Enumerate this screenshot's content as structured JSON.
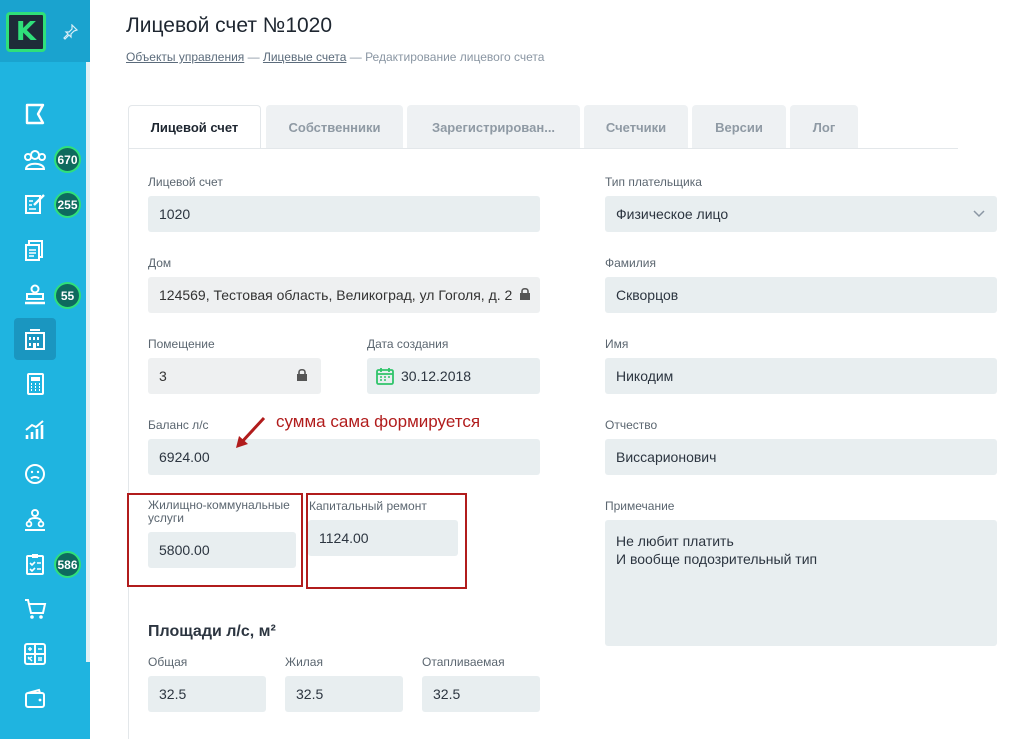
{
  "sidebar": {
    "logo_letter": "K",
    "pin_icon": "pin-icon",
    "items": [
      {
        "icon": "flag-icon",
        "badge": null
      },
      {
        "icon": "people-group-icon",
        "badge": "670"
      },
      {
        "icon": "edit-document-icon",
        "badge": "255"
      },
      {
        "icon": "documents-icon",
        "badge": null
      },
      {
        "icon": "dispatcher-icon",
        "badge": "55"
      },
      {
        "icon": "building-icon",
        "badge": null,
        "active": true
      },
      {
        "icon": "calculator-icon",
        "badge": null
      },
      {
        "icon": "analytics-icon",
        "badge": null
      },
      {
        "icon": "sad-face-icon",
        "badge": null
      },
      {
        "icon": "team-icon",
        "badge": null
      },
      {
        "icon": "checklist-icon",
        "badge": "586"
      },
      {
        "icon": "cart-icon",
        "badge": null
      },
      {
        "icon": "calc-grid-icon",
        "badge": null
      },
      {
        "icon": "wallet-icon",
        "badge": null
      }
    ]
  },
  "header": {
    "title": "Лицевой счет №1020",
    "breadcrumb": {
      "item1": "Объекты управления",
      "sep": " — ",
      "item2": "Лицевые счета",
      "item3": "Редактирование лицевого счета"
    }
  },
  "tabs": [
    "Лицевой счет",
    "Собственники",
    "Зарегистрирован...",
    "Счетчики",
    "Версии",
    "Лог"
  ],
  "form": {
    "account_label": "Лицевой счет",
    "account_value": "1020",
    "house_label": "Дом",
    "house_value": "124569, Тестовая область, Великоград, ул Гоголя, д. 2",
    "room_label": "Помещение",
    "room_value": "3",
    "created_label": "Дата создания",
    "created_value": "30.12.2018",
    "balance_label": "Баланс л/с",
    "balance_value": "6924.00",
    "housing_label": "Жилищно-коммунальные услуги",
    "housing_value": "5800.00",
    "capital_label": "Капитальный ремонт",
    "capital_value": "1124.00",
    "area_title": "Площади л/с, м²",
    "area_total_label": "Общая",
    "area_total_value": "32.5",
    "area_living_label": "Жилая",
    "area_living_value": "32.5",
    "area_heated_label": "Отапливаемая",
    "area_heated_value": "32.5",
    "payer_type_label": "Тип плательщика",
    "payer_type_value": "Физическое лицо",
    "lastname_label": "Фамилия",
    "lastname_value": "Скворцов",
    "firstname_label": "Имя",
    "firstname_value": "Никодим",
    "patronymic_label": "Отчество",
    "patronymic_value": "Виссарионович",
    "note_label": "Примечание",
    "note_line1": "Не любит платить",
    "note_line2": "И вообще подозрительный тип"
  },
  "annotation": {
    "text": "сумма сама формируется",
    "color": "#b11c1c"
  },
  "colors": {
    "sidebar": "#1fb4e0",
    "field_bg": "#e8eef0",
    "accent_green": "#2fe07a"
  }
}
